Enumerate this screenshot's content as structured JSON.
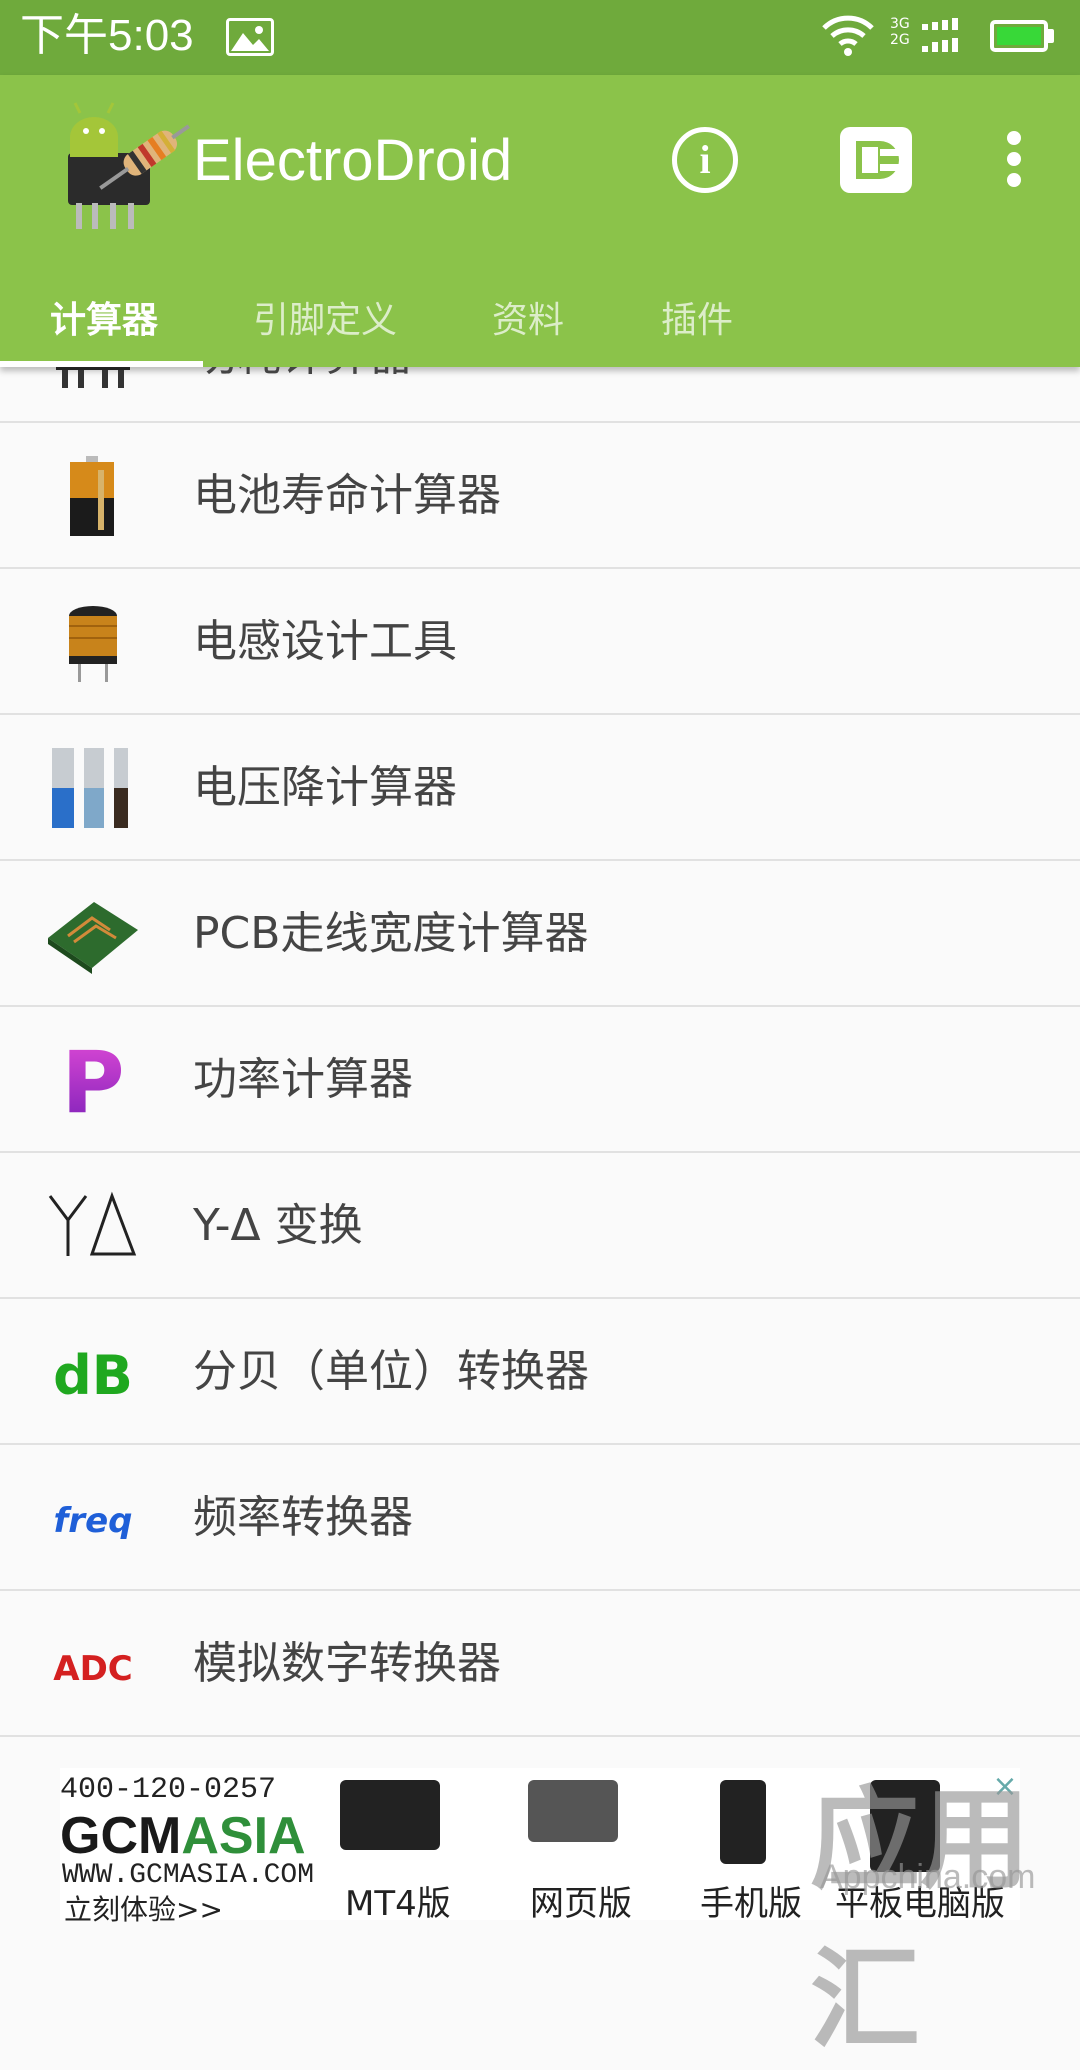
{
  "status_bar": {
    "time": "下午5:03",
    "network_top": "3G",
    "network_bottom": "2G"
  },
  "app_bar": {
    "title": "ElectroDroid",
    "info_icon": "info-icon",
    "plugin_icon": "plug-icon",
    "menu_icon": "more-vert-icon",
    "colors": {
      "background": "#8bc34a",
      "status_bar": "#6faa3c"
    }
  },
  "tabs": [
    {
      "label": "计算器",
      "active": true
    },
    {
      "label": "引脚定义",
      "active": false
    },
    {
      "label": "资料",
      "active": false
    },
    {
      "label": "插件",
      "active": false
    }
  ],
  "list_items": [
    {
      "label": "功耗计算器",
      "icon": "heatsink-icon"
    },
    {
      "label": "电池寿命计算器",
      "icon": "battery-icon"
    },
    {
      "label": "电感设计工具",
      "icon": "inductor-icon"
    },
    {
      "label": "电压降计算器",
      "icon": "wire-icon"
    },
    {
      "label": "PCB走线宽度计算器",
      "icon": "pcb-icon"
    },
    {
      "label": "功率计算器",
      "icon": "power-p-icon",
      "icon_text": "P"
    },
    {
      "label": "Y-Δ 变换",
      "icon": "wye-delta-icon",
      "icon_text": "YΔ"
    },
    {
      "label": "分贝（单位）转换器",
      "icon": "db-icon",
      "icon_text": "dB"
    },
    {
      "label": "频率转换器",
      "icon": "freq-icon",
      "icon_text": "freq"
    },
    {
      "label": "模拟数字转换器",
      "icon": "adc-icon",
      "icon_text": "ADC"
    }
  ],
  "ad": {
    "phone": "400-120-0257",
    "brand_a": "GCM",
    "brand_b": "ASIA",
    "site": "WWW.GCMASIA.COM",
    "cta": "立刻体验>>",
    "labels": [
      "MT4版",
      "网页版",
      "手机版",
      "平板电脑版"
    ]
  },
  "watermark": {
    "text": "应用汇",
    "url": "Appchina.com"
  }
}
